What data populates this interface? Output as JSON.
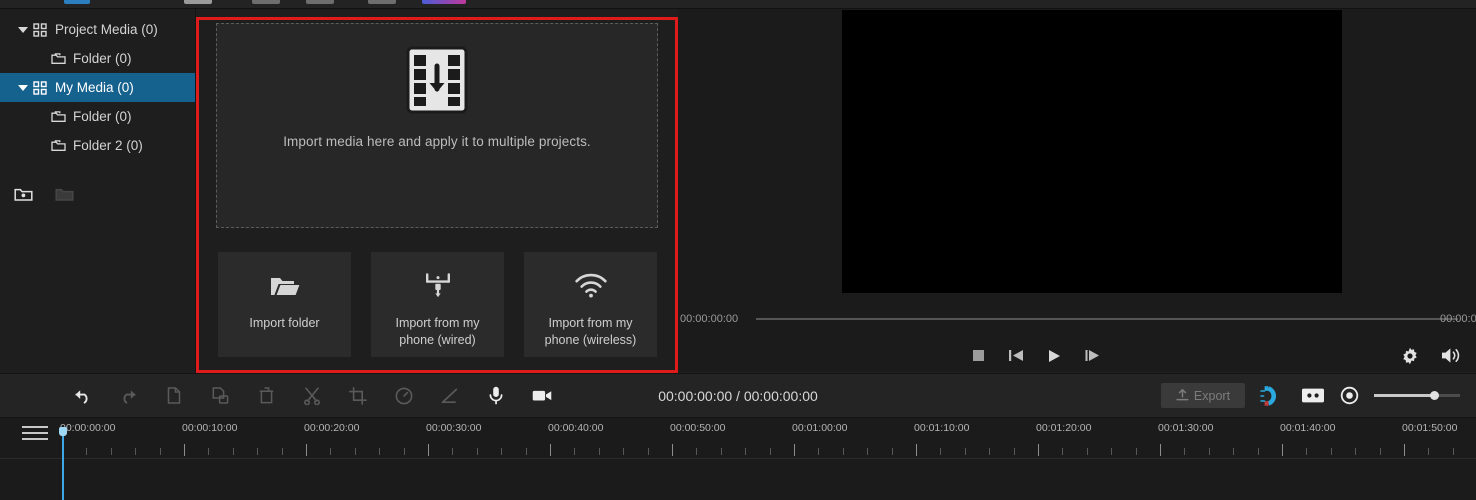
{
  "app": {
    "theme_bg": "#1e1e1e",
    "accent_blue": "#16628f",
    "highlight_red": "#e01b1b"
  },
  "sidebar": {
    "items": [
      {
        "label": "Project Media (0)",
        "icon": "grid-icon",
        "level": 0,
        "expanded": true,
        "selected": false
      },
      {
        "label": "Folder (0)",
        "icon": "folder-icon",
        "level": 1,
        "expanded": false,
        "selected": false
      },
      {
        "label": "My Media (0)",
        "icon": "grid-icon",
        "level": 0,
        "expanded": true,
        "selected": true
      },
      {
        "label": "Folder (0)",
        "icon": "folder-icon",
        "level": 1,
        "expanded": false,
        "selected": false
      },
      {
        "label": "Folder 2 (0)",
        "icon": "folder-icon",
        "level": 1,
        "expanded": false,
        "selected": false
      }
    ],
    "footer_buttons": [
      {
        "name": "new-folder-icon",
        "enabled": true
      },
      {
        "name": "delete-folder-icon",
        "enabled": false
      }
    ]
  },
  "media_panel": {
    "dropzone": {
      "icon": "film-import-icon",
      "text": "Import media here and apply it to multiple projects."
    },
    "buttons": [
      {
        "label": "Import folder",
        "icon": "folder-open-icon"
      },
      {
        "label": "Import from my phone (wired)",
        "icon": "phone-wired-icon"
      },
      {
        "label": "Import from my phone (wireless)",
        "icon": "wifi-icon"
      }
    ]
  },
  "player": {
    "scrubber": {
      "start_time": "00:00:00:00",
      "end_time": "00:00:0"
    },
    "controls": [
      {
        "name": "stop-button",
        "glyph": "stop"
      },
      {
        "name": "previous-frame-button",
        "glyph": "prev-frame"
      },
      {
        "name": "play-button",
        "glyph": "play"
      },
      {
        "name": "next-frame-button",
        "glyph": "next-frame"
      }
    ],
    "right_controls": [
      {
        "name": "settings-gear-icon"
      },
      {
        "name": "volume-icon"
      }
    ]
  },
  "edit_toolbar": {
    "tools": [
      {
        "name": "undo-icon",
        "enabled": true
      },
      {
        "name": "redo-icon",
        "enabled": false
      },
      {
        "name": "copy-icon",
        "enabled": false
      },
      {
        "name": "paste-icon",
        "enabled": false
      },
      {
        "name": "delete-icon",
        "enabled": false
      },
      {
        "name": "split-icon",
        "enabled": false
      },
      {
        "name": "crop-icon",
        "enabled": false
      },
      {
        "name": "speed-icon",
        "enabled": false
      },
      {
        "name": "keyframe-icon",
        "enabled": false
      },
      {
        "name": "microphone-icon",
        "enabled": true
      },
      {
        "name": "record-video-icon",
        "enabled": true
      }
    ],
    "timecode": "00:00:00:00 / 00:00:00:00",
    "export_label": "Export",
    "right_tools": [
      {
        "name": "snap-magnet-icon"
      },
      {
        "name": "marker-icon"
      },
      {
        "name": "zoom-to-fit-icon"
      }
    ],
    "zoom_slider": {
      "value": 70
    }
  },
  "timeline": {
    "menu_icon": "hamburger-menu-icon",
    "playhead_position": "00:00:00:00",
    "major_ticks": [
      "00:00:00:00",
      "00:00:10:00",
      "00:00:20:00",
      "00:00:30:00",
      "00:00:40:00",
      "00:00:50:00",
      "00:01:00:00",
      "00:01:10:00",
      "00:01:20:00",
      "00:01:30:00",
      "00:01:40:00",
      "00:01:50:00"
    ],
    "major_spacing_px": 122,
    "minors_per_major": 5
  }
}
